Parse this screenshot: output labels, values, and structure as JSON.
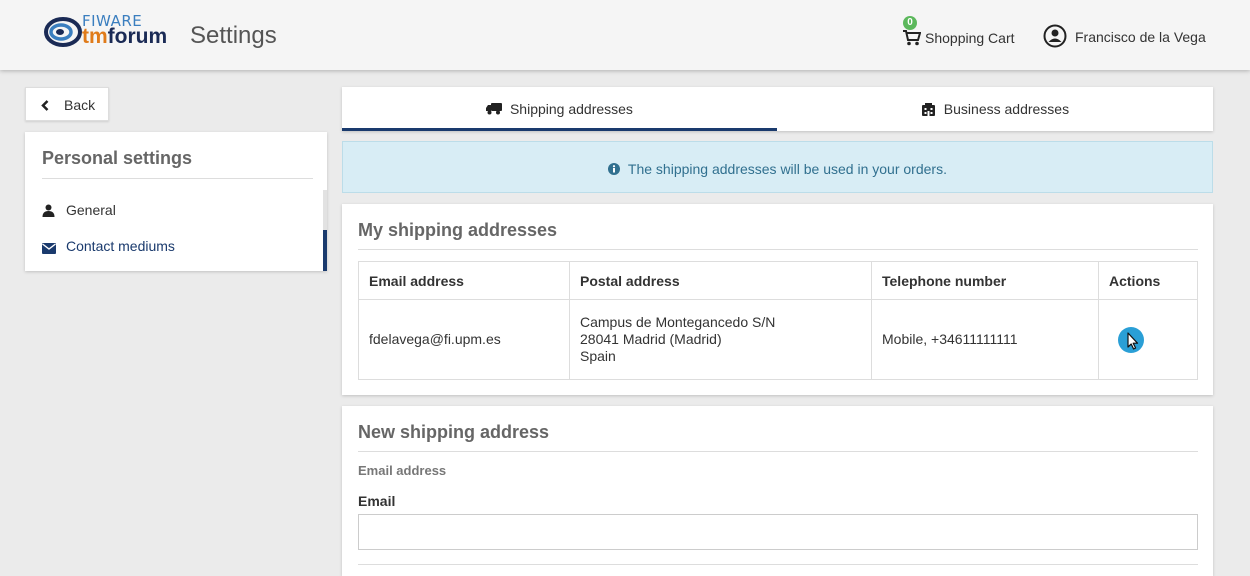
{
  "header": {
    "logo": {
      "top": "FIWARE",
      "bottom_prefix": "tm",
      "bottom_o": "fo",
      "bottom_suffix": "rum"
    },
    "page_title": "Settings",
    "cart": {
      "count": "0",
      "label": "Shopping Cart",
      "icon": "shopping-cart-icon"
    },
    "user": {
      "name": "Francisco de la Vega",
      "icon": "user-circle-icon"
    }
  },
  "sidebar": {
    "back_label": "Back",
    "section_title": "Personal settings",
    "items": [
      {
        "label": "General",
        "icon": "user-icon"
      },
      {
        "label": "Contact mediums",
        "icon": "envelope-icon",
        "active": true
      }
    ]
  },
  "tabs": [
    {
      "label": "Shipping addresses",
      "icon": "truck-icon",
      "active": true
    },
    {
      "label": "Business addresses",
      "icon": "building-icon"
    }
  ],
  "info_message": "The shipping addresses will be used in your orders.",
  "my_addresses": {
    "title": "My shipping addresses",
    "columns": [
      "Email address",
      "Postal address",
      "Telephone number",
      "Actions"
    ],
    "rows": [
      {
        "email": "fdelavega@fi.upm.es",
        "postal_line1": "Campus de Montegancedo S/N",
        "postal_line2": "28041 Madrid (Madrid)",
        "postal_line3": "Spain",
        "phone": "Mobile, +34611111111"
      }
    ]
  },
  "new_address": {
    "title": "New shipping address",
    "section_label": "Email address",
    "email_label": "Email",
    "email_value": ""
  },
  "colors": {
    "accent": "#1a3a6d",
    "info_bg": "#d8edf5",
    "info_text": "#31708f",
    "action": "#2a9fd6",
    "badge": "#5cb85c"
  }
}
